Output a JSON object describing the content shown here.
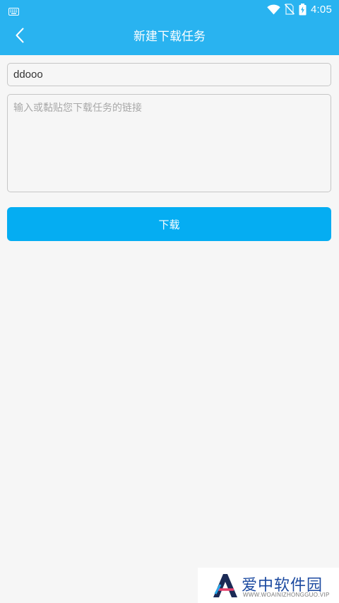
{
  "status_bar": {
    "time": "4:05",
    "icons": [
      "keyboard-icon",
      "wifi-icon",
      "no-sim-icon",
      "battery-charging-icon"
    ]
  },
  "app_bar": {
    "back_icon": "chevron-left-icon",
    "title": "新建下载任务"
  },
  "form": {
    "name_value": "ddooo",
    "link_placeholder": "输入或黏贴您下载任务的链接",
    "link_value": "",
    "download_label": "下载"
  },
  "colors": {
    "accent": "#29b3f0",
    "button": "#05adf2",
    "background": "#f6f6f6"
  },
  "watermark": {
    "title": "爱中软件园",
    "subtitle": "WWW.WOAINIZHONGGUO.VIP"
  }
}
